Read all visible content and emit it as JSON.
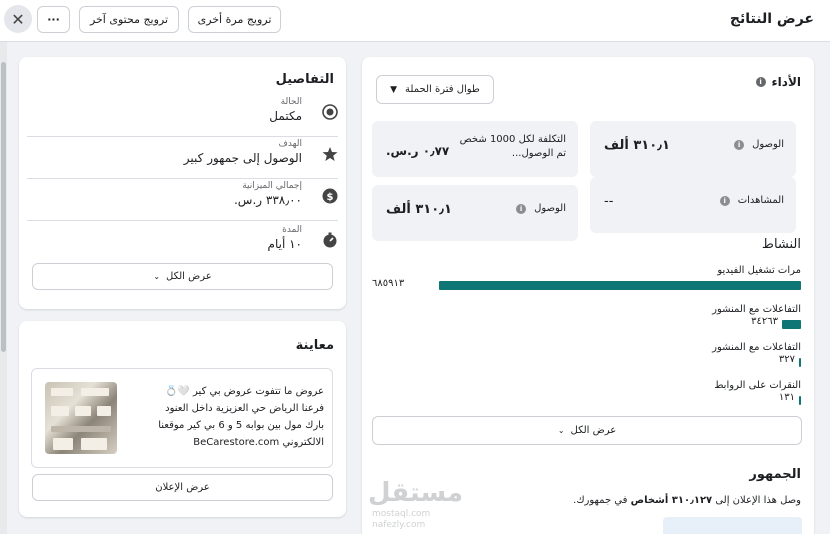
{
  "header": {
    "title": "عرض النتائج",
    "boost_again": "ترويج مرة أخرى",
    "boost_other": "ترويج محتوى آخر",
    "more": "···",
    "close": "✕"
  },
  "details": {
    "title": "التفاصيل",
    "rows": [
      {
        "label": "الحالة",
        "value": "مكتمل",
        "icon": "status-icon"
      },
      {
        "label": "الهدف",
        "value": "الوصول إلى جمهور كبير",
        "icon": "star-icon"
      },
      {
        "label": "إجمالي الميزانية",
        "value": "٣٣٨٫٠٠ ر.س.",
        "icon": "dollar-icon"
      },
      {
        "label": "المدة",
        "value": "١٠ أيام",
        "icon": "stopwatch-icon"
      }
    ],
    "view_all": "عرض الكل"
  },
  "preview": {
    "title": "معاينة",
    "ad_lines": [
      "عروض ما تتفوت عروض بي كير 🤍💍",
      "فرعنا الرياض حي العزيزية داخل العنود",
      "بارك مول بين بوابه 5 و 6 بي كير موقعنا",
      "الالكتروني BeCarestore.com"
    ],
    "view_ad": "عرض الإعلان"
  },
  "performance": {
    "title": "الأداء",
    "period": "طوال فترة الحملة",
    "metrics": [
      {
        "label": "الوصول",
        "value": "٣١٠٫١ ألف"
      },
      {
        "label": "التكلفة لكل 1000 شخص تم الوصول...",
        "value": "٠٫٧٧ ر.س."
      },
      {
        "label": "المشاهدات",
        "value": "--"
      },
      {
        "label": "الوصول",
        "value": "٣١٠٫١ ألف"
      }
    ]
  },
  "activity": {
    "title": "النشاط",
    "items": [
      {
        "label": "مرات تشغيل الفيديو",
        "value": "٦٨٥٩١٣",
        "fraction": 1.0
      },
      {
        "label": "التفاعلات مع المنشور",
        "value": "٣٤٢٦٣",
        "fraction": 0.05
      },
      {
        "label": "التفاعلات مع المنشور",
        "value": "٣٢٧",
        "fraction": 0.0005
      },
      {
        "label": "النقرات على الروابط",
        "value": "١٣١",
        "fraction": 0.0002
      }
    ],
    "view_all": "عرض الكل",
    "bar_color": "#0e7674"
  },
  "audience": {
    "title": "الجمهور",
    "text_prefix": "وصل هذا الإعلان إلى",
    "text_bold": "٣١٠٫١٢٧ أشخاص",
    "text_suffix": "في جمهورك."
  },
  "watermark": {
    "brand": "مستقل",
    "line1": "mostaql.com",
    "line2": "nafezly.com"
  }
}
